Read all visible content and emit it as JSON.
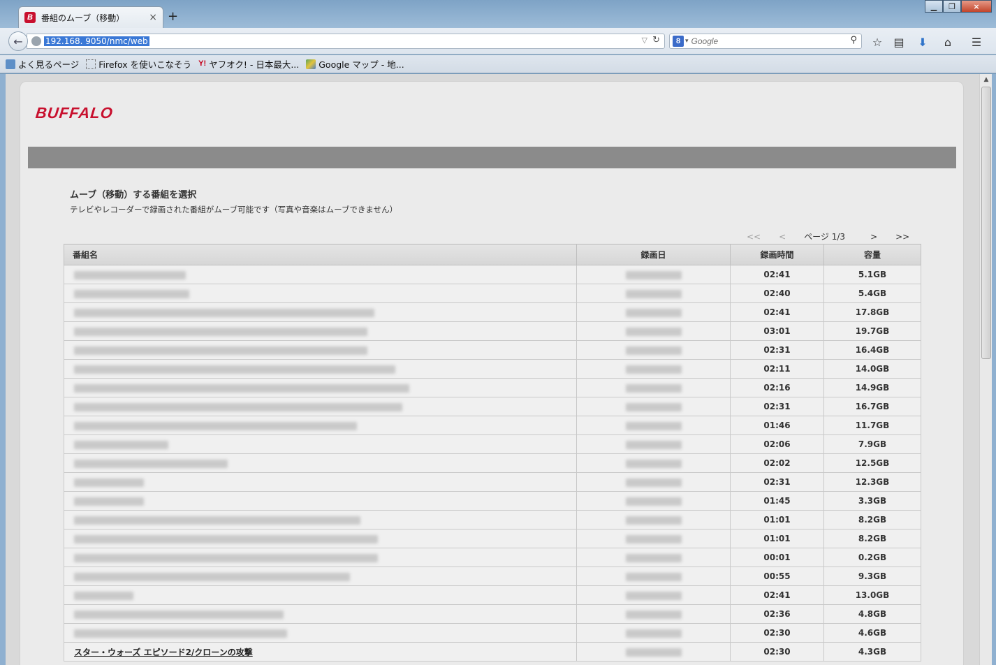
{
  "browser": {
    "tab_title": "番組のムーブ（移動）",
    "tab_icon_letter": "B",
    "close_glyph": "×",
    "new_tab_glyph": "+",
    "url": "192.168.            9050/nmc/web",
    "search_engine_letter": "8",
    "search_placeholder": "Google",
    "bookmarks": [
      {
        "label": "よく見るページ",
        "icon": "page-icon"
      },
      {
        "label": "Firefox を使いこなそう",
        "icon": "dotted-page-icon"
      },
      {
        "label": "ヤフオク! - 日本最大...",
        "icon": "yahoo-icon",
        "icon_text": "Y!"
      },
      {
        "label": "Google マップ - 地...",
        "icon": "maps-icon"
      }
    ]
  },
  "page": {
    "brand": "BUFFALO",
    "section_title": "ムーブ（移動）する番組を選択",
    "section_desc": "テレビやレコーダーで録画された番組がムーブ可能です（写真や音楽はムーブできません）",
    "pager": {
      "first": "<<",
      "prev": "<",
      "status": "ページ 1/3",
      "next": ">",
      "last": ">>"
    },
    "columns": [
      "番組名",
      "録画日",
      "録画時間",
      "容量"
    ],
    "rows": [
      {
        "duration": "02:41",
        "size": "5.1GB"
      },
      {
        "duration": "02:40",
        "size": "5.4GB"
      },
      {
        "duration": "02:41",
        "size": "17.8GB"
      },
      {
        "duration": "03:01",
        "size": "19.7GB"
      },
      {
        "duration": "02:31",
        "size": "16.4GB"
      },
      {
        "duration": "02:11",
        "size": "14.0GB"
      },
      {
        "duration": "02:16",
        "size": "14.9GB"
      },
      {
        "duration": "02:31",
        "size": "16.7GB"
      },
      {
        "duration": "01:46",
        "size": "11.7GB"
      },
      {
        "duration": "02:06",
        "size": "7.9GB"
      },
      {
        "duration": "02:02",
        "size": "12.5GB"
      },
      {
        "duration": "02:31",
        "size": "12.3GB"
      },
      {
        "duration": "01:45",
        "size": "3.3GB"
      },
      {
        "duration": "01:01",
        "size": "8.2GB"
      },
      {
        "duration": "01:01",
        "size": "8.2GB"
      },
      {
        "duration": "00:01",
        "size": "0.2GB"
      },
      {
        "duration": "00:55",
        "size": "9.3GB"
      },
      {
        "duration": "02:41",
        "size": "13.0GB"
      },
      {
        "duration": "02:36",
        "size": "4.8GB"
      },
      {
        "duration": "02:30",
        "size": "4.6GB"
      },
      {
        "duration": "02:30",
        "size": "4.3GB",
        "name": "スター・ウォーズ エピソード2/クローンの攻撃"
      }
    ]
  }
}
